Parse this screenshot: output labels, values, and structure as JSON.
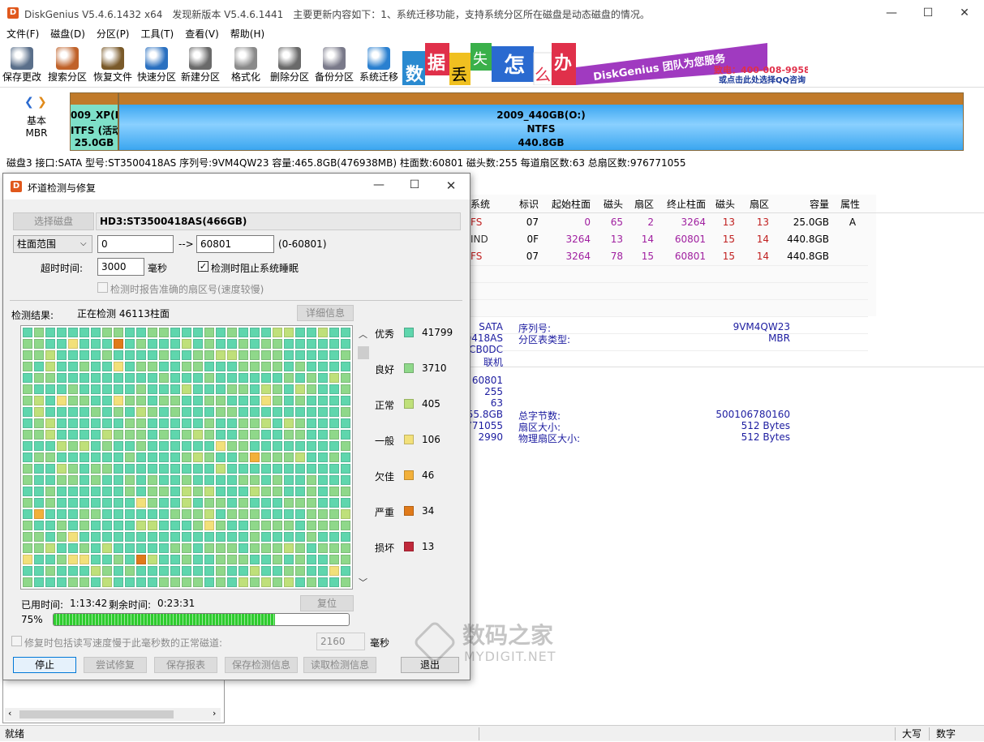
{
  "window": {
    "app": "DiskGenius V5.4.6.1432 x64",
    "update": "发现新版本 V5.4.6.1441",
    "update_desc": "主要更新内容如下：1、系统迁移功能，支持系统分区所在磁盘是动态磁盘的情况。"
  },
  "menu": [
    "文件(F)",
    "磁盘(D)",
    "分区(P)",
    "工具(T)",
    "查看(V)",
    "帮助(H)"
  ],
  "toolbar": [
    {
      "label": "保存更改",
      "icon": "save-icon",
      "color": "#5a6f8a"
    },
    {
      "label": "搜索分区",
      "icon": "magnifier-icon",
      "color": "#c0622a"
    },
    {
      "label": "恢复文件",
      "icon": "recover-box-icon",
      "color": "#7a5a2a"
    },
    {
      "label": "快速分区",
      "icon": "quick-partition-icon",
      "color": "#2a70c0"
    },
    {
      "label": "新建分区",
      "icon": "layers-icon",
      "color": "#6a6a6a"
    },
    {
      "label": "格式化",
      "icon": "format-disk-icon",
      "color": "#8a8a8a"
    },
    {
      "label": "删除分区",
      "icon": "trash-icon",
      "color": "#6a6a6a"
    },
    {
      "label": "备份分区",
      "icon": "backup-disc-icon",
      "color": "#7a7a8a"
    },
    {
      "label": "系统迁移",
      "icon": "migrate-icon",
      "color": "#2a80d0"
    }
  ],
  "ad": {
    "chars": [
      "数",
      "据",
      "丢",
      "失",
      "怎",
      "么",
      "办"
    ],
    "slogan": "DiskGenius 团队为您服务",
    "phone": "致电：400-008-9958",
    "qq": "或点击此处选择QQ咨询"
  },
  "disk": {
    "type": "基本",
    "scheme": "MBR",
    "p1_name": "009_XP(F:",
    "p1_fs": "ITFS (活动",
    "p1_size": "25.0GB",
    "p2_name": "2009_440GB(O:)",
    "p2_fs": "NTFS",
    "p2_size": "440.8GB"
  },
  "diskmeta": "磁盘3 接口:SATA 型号:ST3500418AS 序列号:9VM4QW23 容量:465.8GB(476938MB) 柱面数:60801 磁头数:255 每道扇区数:63 总扇区数:976771055",
  "table": {
    "headers": [
      "系统",
      "标识",
      "起始柱面",
      "磁头",
      "扇区",
      "终止柱面",
      "磁头",
      "扇区",
      "容量",
      "属性"
    ],
    "rows": [
      [
        "FS",
        "07",
        "0",
        "65",
        "2",
        "3264",
        "13",
        "13",
        "25.0GB",
        "A"
      ],
      [
        "IND",
        "0F",
        "3264",
        "13",
        "14",
        "60801",
        "15",
        "14",
        "440.8GB",
        ""
      ],
      [
        "FS",
        "07",
        "3264",
        "78",
        "15",
        "60801",
        "15",
        "14",
        "440.8GB",
        ""
      ]
    ]
  },
  "info": {
    "left": [
      "SATA",
      "0418AS",
      "CB0DC",
      "联机",
      "60801",
      "255",
      "63",
      "55.8GB",
      "771055",
      "2990"
    ],
    "mid": [
      "序列号:",
      "分区表类型:",
      "总字节数:",
      "扇区大小:",
      "物理扇区大小:"
    ],
    "right": [
      "9VM4QW23",
      "MBR",
      "500106780160",
      "512 Bytes",
      "512 Bytes"
    ]
  },
  "dialog": {
    "title": "坏道检测与修复",
    "select_disk": "选择磁盘",
    "disk_name": "HD3:ST3500418AS(466GB)",
    "range_select": "柱面范围",
    "range_from": "0",
    "arrow": "-->",
    "range_to": "60801",
    "range_hint": "(0-60801)",
    "timeout_label": "超时时间:",
    "timeout_value": "3000",
    "timeout_unit": "毫秒",
    "prevent_sleep": "检测时阻止系统睡眠",
    "report_sector": "检测时报告准确的扇区号(速度较慢)",
    "result_label": "检测结果:",
    "status": "正在检测 46113柱面",
    "detail_button": "详细信息",
    "legend": [
      {
        "label": "优秀",
        "count": "41799",
        "color": "#5fd6ad"
      },
      {
        "label": "良好",
        "count": "3710",
        "color": "#8fd88a"
      },
      {
        "label": "正常",
        "count": "405",
        "color": "#bfe07a"
      },
      {
        "label": "一般",
        "count": "106",
        "color": "#f2e07a"
      },
      {
        "label": "欠佳",
        "count": "46",
        "color": "#f2b03a"
      },
      {
        "label": "严重",
        "count": "34",
        "color": "#e07a1a"
      },
      {
        "label": "损坏",
        "count": "13",
        "color": "#c0283a"
      }
    ],
    "elapsed_label": "已用时间:",
    "elapsed": "1:13:42",
    "remaining_label": "剩余时间:",
    "remaining": "0:23:31",
    "reset_button": "复位",
    "progress_text": "75%",
    "progress": 0.75,
    "repair_option": "修复时包括读写速度慢于此毫秒数的正常磁道:",
    "repair_ms": "2160",
    "repair_unit": "毫秒",
    "buttons": [
      "停止",
      "尝试修复",
      "保存报表",
      "保存检测信息",
      "读取检测信息",
      "退出"
    ]
  },
  "status": {
    "left": "就绪",
    "caps": "大写",
    "num": "数字"
  },
  "watermark": {
    "cn": "数码之家",
    "en": "MYDIGIT.NET"
  }
}
